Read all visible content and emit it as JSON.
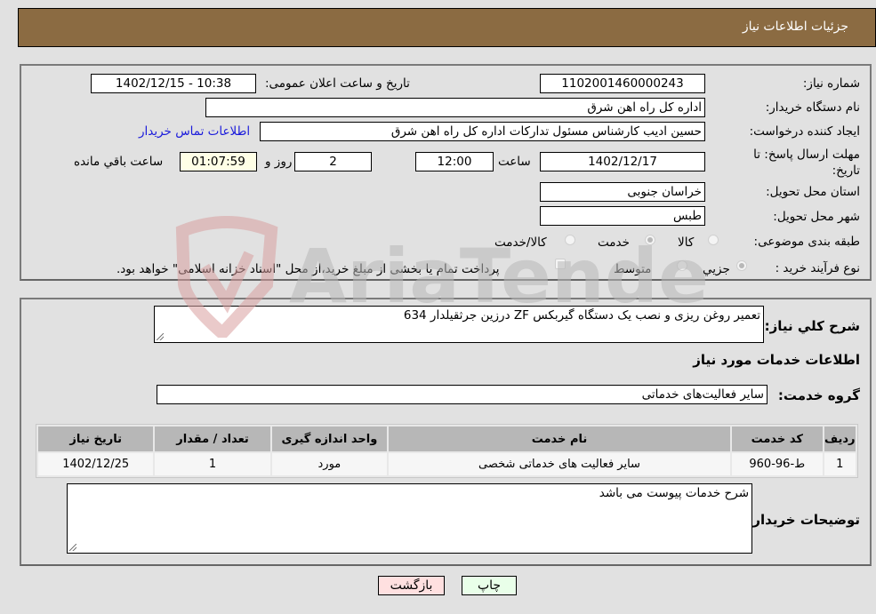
{
  "header": {
    "title": "جزئیات اطلاعات نیاز"
  },
  "form": {
    "need_number_label": "شماره نیاز:",
    "need_number": "1102001460000243",
    "announce_label": "تاریخ و ساعت اعلان عمومی:",
    "announce_value": "1402/12/15 - 10:38",
    "buyer_org_label": "نام دستگاه خریدار:",
    "buyer_org": "اداره کل راه اهن شرق",
    "requester_label": "ایجاد کننده درخواست:",
    "requester": "حسین ادیب کارشناس مسئول تدارکات اداره کل راه اهن شرق",
    "buyer_contact_link": "اطلاعات تماس خریدار",
    "deadline_label_line1": "مهلت ارسال پاسخ: تا",
    "deadline_label_line2": "تاریخ:",
    "deadline_date": "1402/12/17",
    "time_label": "ساعت",
    "deadline_time": "12:00",
    "days_value": "2",
    "days_label": "روز و",
    "remaining_time": "01:07:59",
    "remaining_label": "ساعت باقي مانده",
    "province_label": "استان محل تحویل:",
    "province": "خراسان جنوبی",
    "city_label": "شهر محل تحویل:",
    "city": "طبس",
    "category_label": "طبقه بندی موضوعی:",
    "category_options": [
      {
        "label": "کالا",
        "checked": false
      },
      {
        "label": "خدمت",
        "checked": true
      },
      {
        "label": "کالا/خدمت",
        "checked": false
      }
    ],
    "purchase_type_label": "نوع فرآیند خرید :",
    "purchase_type_options": [
      {
        "label": "جزيي",
        "checked": true
      },
      {
        "label": "متوسط",
        "checked": false
      }
    ],
    "treasury_note": "پرداخت تمام یا بخشی از مبلغ خرید،از محل \"اسناد خزانه اسلامی\" خواهد بود."
  },
  "details": {
    "summary_label": "شرح کلي نياز:",
    "summary": "تعمیر روغن ریزی و نصب یک دستگاه گیربکس ZF درزین جرثقیلدار 634",
    "services_heading": "اطلاعات خدمات مورد نیاز",
    "service_group_label": "گروه خدمت:",
    "service_group": "سایر فعالیت‌های خدماتی",
    "table": {
      "headers": [
        "ردیف",
        "کد خدمت",
        "نام خدمت",
        "واحد اندازه گیری",
        "تعداد / مقدار",
        "تاریخ نیاز"
      ],
      "rows": [
        [
          "1",
          "ط-96-960",
          "سایر فعالیت های خدماتی شخصی",
          "مورد",
          "1",
          "1402/12/25"
        ]
      ]
    },
    "buyer_notes_label": "توضیحات خریدار:",
    "buyer_notes": "شرح خدمات پیوست می باشد"
  },
  "buttons": {
    "print": "چاپ",
    "back": "بازگشت"
  },
  "watermark": {
    "text": "AriaTender.neT"
  }
}
